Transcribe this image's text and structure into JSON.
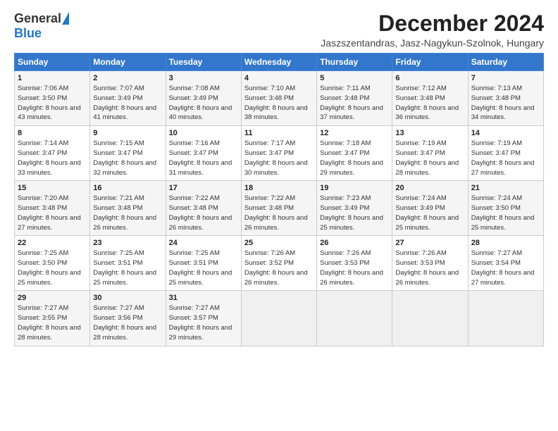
{
  "header": {
    "logo_general": "General",
    "logo_blue": "Blue",
    "month_title": "December 2024",
    "location": "Jaszszentandras, Jasz-Nagykun-Szolnok, Hungary"
  },
  "weekdays": [
    "Sunday",
    "Monday",
    "Tuesday",
    "Wednesday",
    "Thursday",
    "Friday",
    "Saturday"
  ],
  "weeks": [
    [
      {
        "day": "1",
        "sunrise": "Sunrise: 7:06 AM",
        "sunset": "Sunset: 3:50 PM",
        "daylight": "Daylight: 8 hours and 43 minutes."
      },
      {
        "day": "2",
        "sunrise": "Sunrise: 7:07 AM",
        "sunset": "Sunset: 3:49 PM",
        "daylight": "Daylight: 8 hours and 41 minutes."
      },
      {
        "day": "3",
        "sunrise": "Sunrise: 7:08 AM",
        "sunset": "Sunset: 3:49 PM",
        "daylight": "Daylight: 8 hours and 40 minutes."
      },
      {
        "day": "4",
        "sunrise": "Sunrise: 7:10 AM",
        "sunset": "Sunset: 3:48 PM",
        "daylight": "Daylight: 8 hours and 38 minutes."
      },
      {
        "day": "5",
        "sunrise": "Sunrise: 7:11 AM",
        "sunset": "Sunset: 3:48 PM",
        "daylight": "Daylight: 8 hours and 37 minutes."
      },
      {
        "day": "6",
        "sunrise": "Sunrise: 7:12 AM",
        "sunset": "Sunset: 3:48 PM",
        "daylight": "Daylight: 8 hours and 36 minutes."
      },
      {
        "day": "7",
        "sunrise": "Sunrise: 7:13 AM",
        "sunset": "Sunset: 3:48 PM",
        "daylight": "Daylight: 8 hours and 34 minutes."
      }
    ],
    [
      {
        "day": "8",
        "sunrise": "Sunrise: 7:14 AM",
        "sunset": "Sunset: 3:47 PM",
        "daylight": "Daylight: 8 hours and 33 minutes."
      },
      {
        "day": "9",
        "sunrise": "Sunrise: 7:15 AM",
        "sunset": "Sunset: 3:47 PM",
        "daylight": "Daylight: 8 hours and 32 minutes."
      },
      {
        "day": "10",
        "sunrise": "Sunrise: 7:16 AM",
        "sunset": "Sunset: 3:47 PM",
        "daylight": "Daylight: 8 hours and 31 minutes."
      },
      {
        "day": "11",
        "sunrise": "Sunrise: 7:17 AM",
        "sunset": "Sunset: 3:47 PM",
        "daylight": "Daylight: 8 hours and 30 minutes."
      },
      {
        "day": "12",
        "sunrise": "Sunrise: 7:18 AM",
        "sunset": "Sunset: 3:47 PM",
        "daylight": "Daylight: 8 hours and 29 minutes."
      },
      {
        "day": "13",
        "sunrise": "Sunrise: 7:19 AM",
        "sunset": "Sunset: 3:47 PM",
        "daylight": "Daylight: 8 hours and 28 minutes."
      },
      {
        "day": "14",
        "sunrise": "Sunrise: 7:19 AM",
        "sunset": "Sunset: 3:47 PM",
        "daylight": "Daylight: 8 hours and 27 minutes."
      }
    ],
    [
      {
        "day": "15",
        "sunrise": "Sunrise: 7:20 AM",
        "sunset": "Sunset: 3:48 PM",
        "daylight": "Daylight: 8 hours and 27 minutes."
      },
      {
        "day": "16",
        "sunrise": "Sunrise: 7:21 AM",
        "sunset": "Sunset: 3:48 PM",
        "daylight": "Daylight: 8 hours and 26 minutes."
      },
      {
        "day": "17",
        "sunrise": "Sunrise: 7:22 AM",
        "sunset": "Sunset: 3:48 PM",
        "daylight": "Daylight: 8 hours and 26 minutes."
      },
      {
        "day": "18",
        "sunrise": "Sunrise: 7:22 AM",
        "sunset": "Sunset: 3:48 PM",
        "daylight": "Daylight: 8 hours and 26 minutes."
      },
      {
        "day": "19",
        "sunrise": "Sunrise: 7:23 AM",
        "sunset": "Sunset: 3:49 PM",
        "daylight": "Daylight: 8 hours and 25 minutes."
      },
      {
        "day": "20",
        "sunrise": "Sunrise: 7:24 AM",
        "sunset": "Sunset: 3:49 PM",
        "daylight": "Daylight: 8 hours and 25 minutes."
      },
      {
        "day": "21",
        "sunrise": "Sunrise: 7:24 AM",
        "sunset": "Sunset: 3:50 PM",
        "daylight": "Daylight: 8 hours and 25 minutes."
      }
    ],
    [
      {
        "day": "22",
        "sunrise": "Sunrise: 7:25 AM",
        "sunset": "Sunset: 3:50 PM",
        "daylight": "Daylight: 8 hours and 25 minutes."
      },
      {
        "day": "23",
        "sunrise": "Sunrise: 7:25 AM",
        "sunset": "Sunset: 3:51 PM",
        "daylight": "Daylight: 8 hours and 25 minutes."
      },
      {
        "day": "24",
        "sunrise": "Sunrise: 7:25 AM",
        "sunset": "Sunset: 3:51 PM",
        "daylight": "Daylight: 8 hours and 25 minutes."
      },
      {
        "day": "25",
        "sunrise": "Sunrise: 7:26 AM",
        "sunset": "Sunset: 3:52 PM",
        "daylight": "Daylight: 8 hours and 26 minutes."
      },
      {
        "day": "26",
        "sunrise": "Sunrise: 7:26 AM",
        "sunset": "Sunset: 3:53 PM",
        "daylight": "Daylight: 8 hours and 26 minutes."
      },
      {
        "day": "27",
        "sunrise": "Sunrise: 7:26 AM",
        "sunset": "Sunset: 3:53 PM",
        "daylight": "Daylight: 8 hours and 26 minutes."
      },
      {
        "day": "28",
        "sunrise": "Sunrise: 7:27 AM",
        "sunset": "Sunset: 3:54 PM",
        "daylight": "Daylight: 8 hours and 27 minutes."
      }
    ],
    [
      {
        "day": "29",
        "sunrise": "Sunrise: 7:27 AM",
        "sunset": "Sunset: 3:55 PM",
        "daylight": "Daylight: 8 hours and 28 minutes."
      },
      {
        "day": "30",
        "sunrise": "Sunrise: 7:27 AM",
        "sunset": "Sunset: 3:56 PM",
        "daylight": "Daylight: 8 hours and 28 minutes."
      },
      {
        "day": "31",
        "sunrise": "Sunrise: 7:27 AM",
        "sunset": "Sunset: 3:57 PM",
        "daylight": "Daylight: 8 hours and 29 minutes."
      },
      null,
      null,
      null,
      null
    ]
  ]
}
